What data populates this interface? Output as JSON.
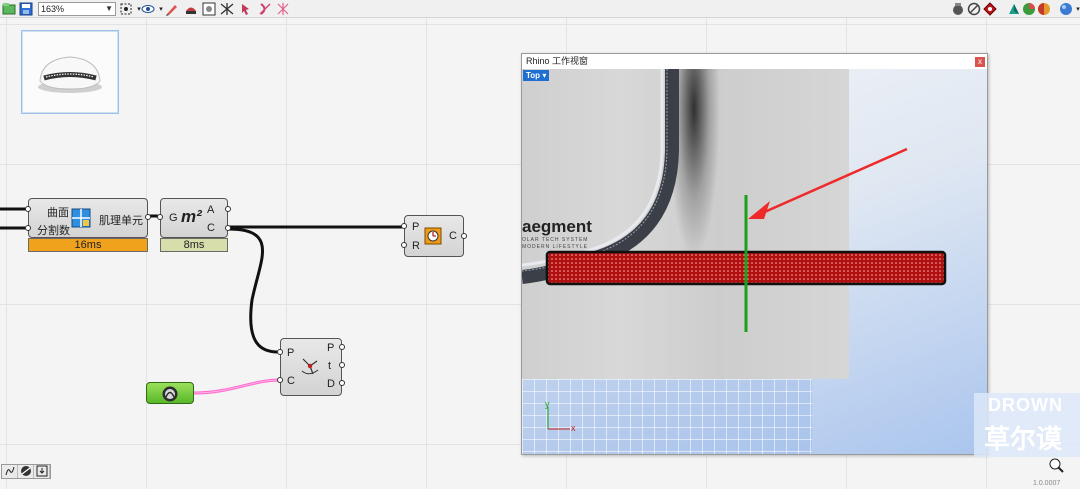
{
  "toolbar": {
    "zoom_value": "163%"
  },
  "components": {
    "tissue": {
      "inputs": [
        "曲面",
        "分割数"
      ],
      "output": "肌理单元",
      "time": "16ms"
    },
    "area": {
      "input": "G",
      "outputs": [
        "A",
        "C"
      ],
      "glyph": "m²",
      "time": "8ms"
    },
    "point_comp": {
      "inputs": [
        "P",
        "R"
      ],
      "output": "C"
    },
    "closest": {
      "inputs": [
        "P",
        "C"
      ],
      "outputs": [
        "P",
        "t",
        "D"
      ]
    }
  },
  "viewport": {
    "title": "Rhino 工作视窗",
    "close_label": "x",
    "view_name": "Top",
    "view_arrow": "▾",
    "brand": "aegment",
    "brand_sub_1": "OLAR TECH SYSTEM",
    "brand_sub_2": "MODERN LIFESTYLE",
    "axis_x": "x",
    "axis_y": "y"
  },
  "watermark": {
    "latin": "DROWN",
    "chinese": "草尔谟"
  },
  "status": {
    "version": "1.0.0007"
  },
  "colors": {
    "time_orange": "#f0a21c",
    "time_olive": "#d8ddac",
    "wire_pink": "#ff66cc",
    "accent_green": "#1aa01a",
    "red_block": "#b01010",
    "arrow_red": "#ee2a2a"
  }
}
